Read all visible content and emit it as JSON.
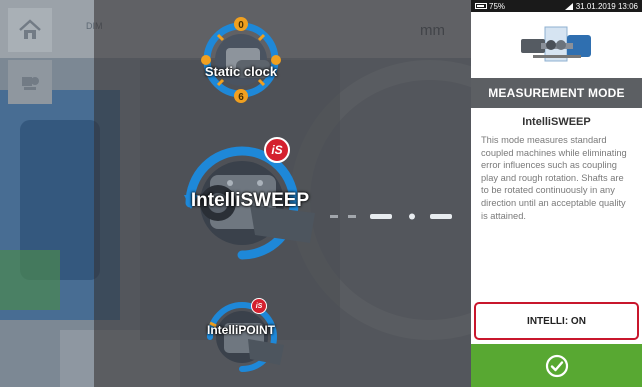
{
  "status_bar": {
    "battery": "75%",
    "datetime": "31.01.2019 13:06"
  },
  "toolbar": {
    "home_icon": "home-icon",
    "machine_icon": "machine-direction-icon",
    "dimension_label": "DIM",
    "unit": "mm"
  },
  "modes": [
    {
      "label": "Static clock",
      "icon": "static-clock-icon"
    },
    {
      "label": "IntelliSWEEP",
      "icon": "intellisweep-icon",
      "badge": "iS"
    },
    {
      "label": "IntelliPOINT",
      "icon": "intellipoint-icon",
      "badge": "iS"
    }
  ],
  "panel": {
    "image_icon": "coupled-machines-icon",
    "header": "MEASUREMENT MODE",
    "subtitle": "IntelliSWEEP",
    "description": "This mode measures standard coupled machines while eliminating error influences such as coupling play and rough rotation. Shafts are to be rotated continuously in any direction until an acceptable quality is attained.",
    "intelli_button": "INTELLI: ON",
    "confirm_icon": "check-circle-icon"
  },
  "colors": {
    "accent_green": "#58a832",
    "highlight_red": "#c8162c",
    "header_gray": "#5c5f63",
    "sweep_blue": "#1e88d8",
    "clock_orange": "#f0a020"
  }
}
